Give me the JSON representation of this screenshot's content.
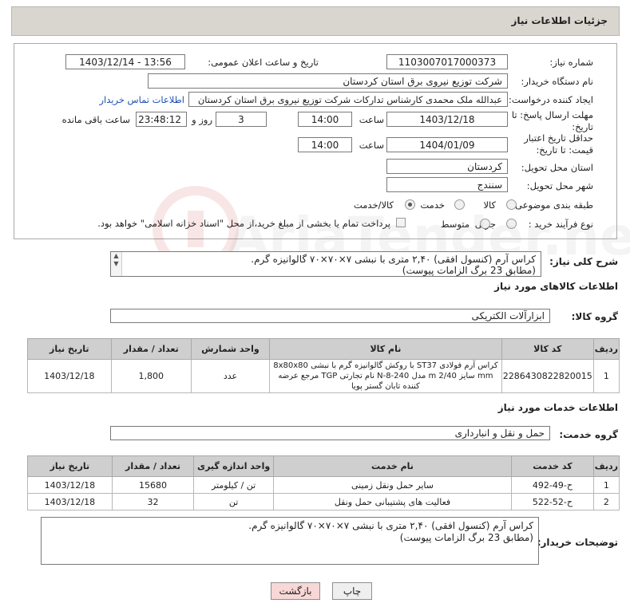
{
  "header": {
    "title": "جزئیات اطلاعات نیاز"
  },
  "form": {
    "need_number_label": "شماره نیاز:",
    "need_number": "1103007017000373",
    "announce_label": "تاریخ و ساعت اعلان عمومی:",
    "announce_value": "1403/12/14 - 13:56",
    "buyer_org_label": "نام دستگاه خریدار:",
    "buyer_org": "شرکت توزیع نیروی برق استان کردستان",
    "creator_label": "ایجاد کننده درخواست:",
    "creator": "عبدالله ملک محمدی کارشناس تدارکات شرکت توزیع نیروی برق استان کردستان",
    "contact_link": "اطلاعات تماس خریدار",
    "reply_deadline_label": "مهلت ارسال پاسخ: تا تاریخ:",
    "reply_date": "1403/12/18",
    "time_label": "ساعت",
    "reply_time": "14:00",
    "days_value": "3",
    "days_label": "روز و",
    "remaining_time": "23:48:12",
    "remaining_label": "ساعت باقی مانده",
    "price_validity_label": "حداقل تاریخ اعتبار قیمت: تا تاریخ:",
    "price_date": "1404/01/09",
    "price_time": "14:00",
    "province_label": "استان محل تحویل:",
    "province": "کردستان",
    "city_label": "شهر محل تحویل:",
    "city": "سنندج",
    "category_label": "طبقه بندی موضوعی:",
    "category_options": [
      "کالا",
      "خدمت",
      "کالا/خدمت"
    ],
    "process_label": "نوع فرآیند خرید :",
    "process_options": [
      "جزیی",
      "متوسط"
    ],
    "payment_note": "پرداخت تمام یا بخشی از مبلغ خرید،از محل \"اسناد خزانه اسلامی\" خواهد بود."
  },
  "description": {
    "label": "شرح کلی نیاز:",
    "line1": "کراس آرم (کنسول افقی) ۲,۴۰ متری با نبشی ۷×۷۰×۷۰ گالوانیزه گرم.",
    "line2": "(مطابق 23 برگ الزامات پیوست)"
  },
  "goods": {
    "section_title": "اطلاعات کالاهای مورد نیاز",
    "group_label": "گروه کالا:",
    "group_value": "ابزارآلات الکتریکی",
    "headers": [
      "ردیف",
      "کد کالا",
      "نام کالا",
      "واحد شمارش",
      "تعداد / مقدار",
      "تاریخ نیاز"
    ],
    "rows": [
      {
        "row": "1",
        "code": "2286430822820015",
        "name_line1": "کراس آرم فولادی ST37 با روکش گالوانیزه گرم با نبشی 8x80x80",
        "name_line2": "mm سایز m 2/40 مدل N-8-240 نام تجارتی TGP مرجع عرضه",
        "name_line3": "کننده تابان گستر پویا",
        "unit": "عدد",
        "qty": "1,800",
        "date": "1403/12/18"
      }
    ]
  },
  "services": {
    "section_title": "اطلاعات خدمات مورد نیاز",
    "group_label": "گروه خدمت:",
    "group_value": "حمل و نقل و انبارداری",
    "headers": [
      "ردیف",
      "کد خدمت",
      "نام خدمت",
      "واحد اندازه گیری",
      "تعداد / مقدار",
      "تاریخ نیاز"
    ],
    "rows": [
      {
        "row": "1",
        "code": "ح-49-492",
        "name": "سایر حمل ونقل زمینی",
        "unit": "تن / کیلومتر",
        "qty": "15680",
        "date": "1403/12/18"
      },
      {
        "row": "2",
        "code": "ح-52-522",
        "name": "فعالیت های پشتیبانی حمل ونقل",
        "unit": "تن",
        "qty": "32",
        "date": "1403/12/18"
      }
    ]
  },
  "buyer_notes": {
    "label": "توضیحات خریدار:",
    "line1": "کراس آرم (کنسول افقی) ۲,۴۰ متری با نبشی ۷×۷۰×۷۰ گالوانیزه گرم.",
    "line2": "(مطابق 23 برگ الزامات پیوست)"
  },
  "buttons": {
    "print": "چاپ",
    "back": "بازگشت"
  },
  "watermark": {
    "brand": "AriaTender.neT"
  },
  "colors": {
    "header_bg": "#d9d6d0",
    "table_header": "#cfcfcf",
    "back_btn": "#f8d7d7",
    "print_btn": "#efefef",
    "link": "#1f4fb5"
  }
}
